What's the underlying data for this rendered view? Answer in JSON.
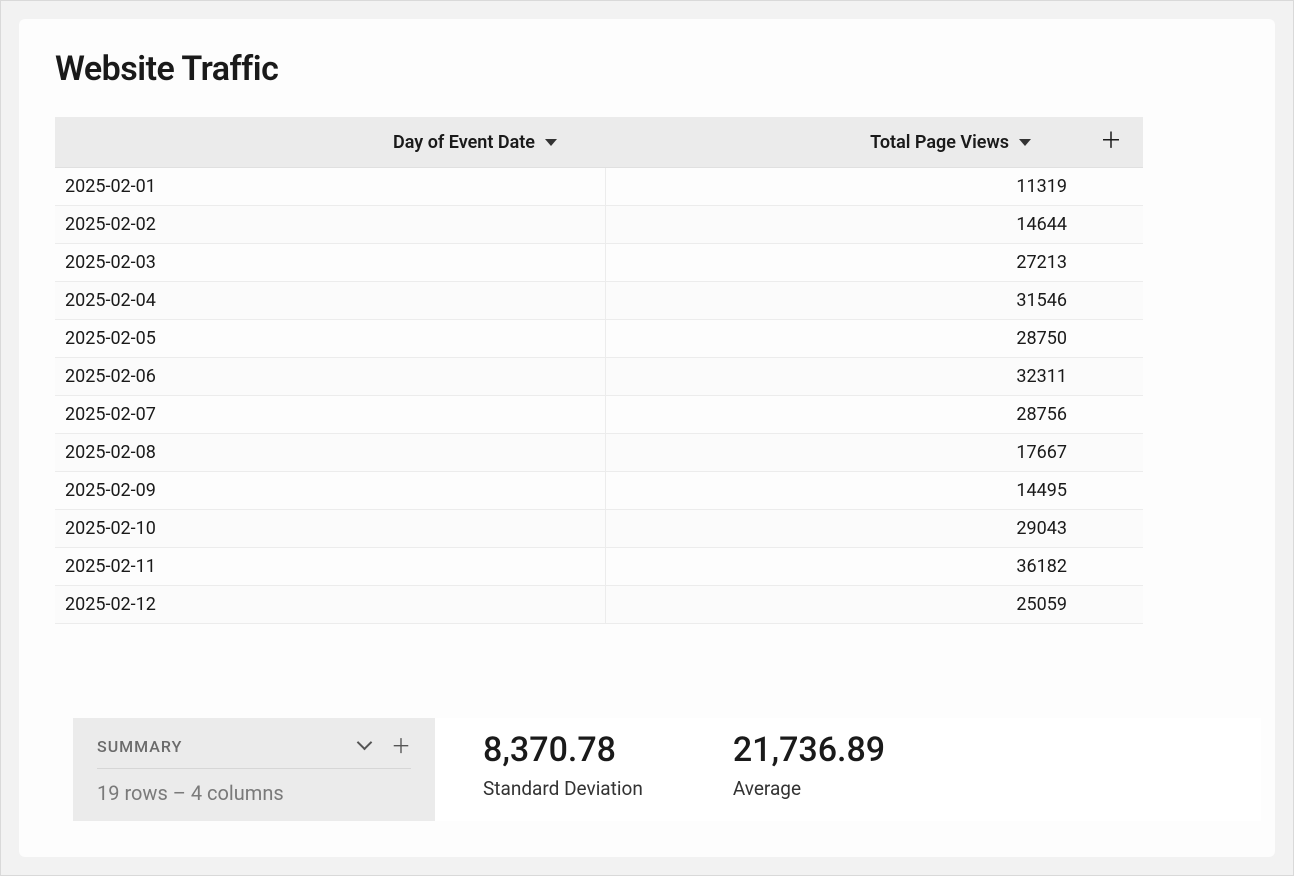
{
  "title": "Website Traffic",
  "columns": {
    "date": "Day of Event Date",
    "views": "Total Page Views"
  },
  "rows": [
    {
      "date": "2025-02-01",
      "views": "11319"
    },
    {
      "date": "2025-02-02",
      "views": "14644"
    },
    {
      "date": "2025-02-03",
      "views": "27213"
    },
    {
      "date": "2025-02-04",
      "views": "31546"
    },
    {
      "date": "2025-02-05",
      "views": "28750"
    },
    {
      "date": "2025-02-06",
      "views": "32311"
    },
    {
      "date": "2025-02-07",
      "views": "28756"
    },
    {
      "date": "2025-02-08",
      "views": "17667"
    },
    {
      "date": "2025-02-09",
      "views": "14495"
    },
    {
      "date": "2025-02-10",
      "views": "29043"
    },
    {
      "date": "2025-02-11",
      "views": "36182"
    },
    {
      "date": "2025-02-12",
      "views": "25059"
    }
  ],
  "summary": {
    "label": "SUMMARY",
    "sub": "19 rows – 4 columns",
    "metrics": [
      {
        "value": "8,370.78",
        "label": "Standard Deviation"
      },
      {
        "value": "21,736.89",
        "label": "Average"
      }
    ]
  }
}
